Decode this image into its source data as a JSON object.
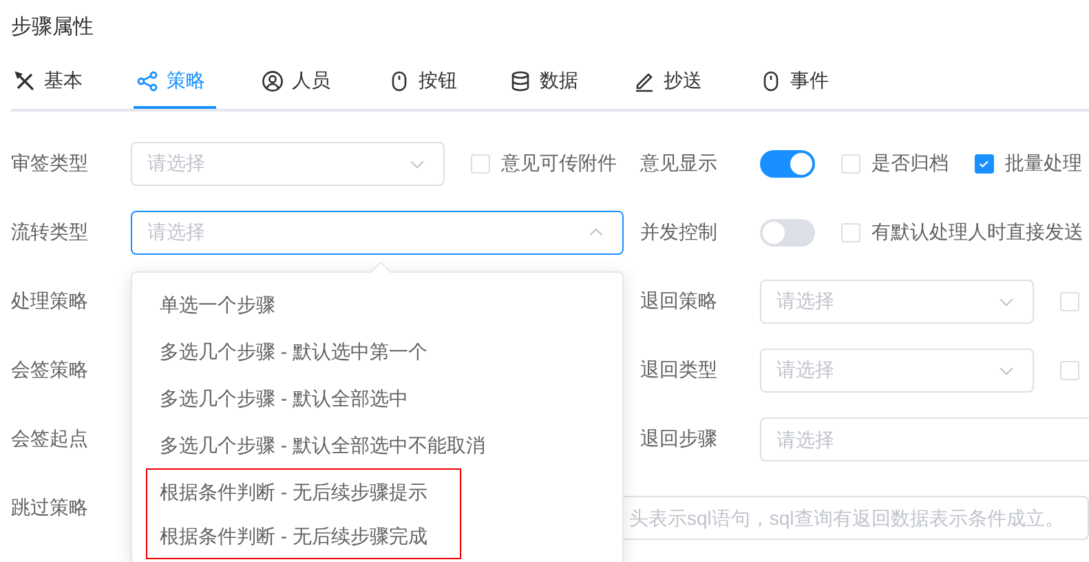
{
  "title": "步骤属性",
  "tabs": [
    {
      "label": "基本",
      "selected": false
    },
    {
      "label": "策略",
      "selected": true
    },
    {
      "label": "人员",
      "selected": false
    },
    {
      "label": "按钮",
      "selected": false
    },
    {
      "label": "数据",
      "selected": false
    },
    {
      "label": "抄送",
      "selected": false
    },
    {
      "label": "事件",
      "selected": false
    }
  ],
  "rows": [
    {
      "left": {
        "label": "审签类型",
        "select": {
          "placeholder": "请选择",
          "open": false
        },
        "checks": [
          {
            "label": "意见可传附件",
            "checked": false
          }
        ]
      },
      "right": {
        "label": "意见显示",
        "switch": {
          "on": true
        },
        "checks": [
          {
            "label": "是否归档",
            "checked": false
          },
          {
            "label": "批量处理",
            "checked": true
          }
        ]
      }
    },
    {
      "left": {
        "label": "流转类型",
        "select": {
          "placeholder": "请选择",
          "open": true
        }
      },
      "right": {
        "label": "并发控制",
        "switch": {
          "on": false
        },
        "checks": [
          {
            "label": "有默认处理人时直接发送",
            "checked": false
          }
        ]
      }
    },
    {
      "left": {
        "label": "处理策略"
      },
      "right": {
        "label": "退回策略",
        "select": {
          "placeholder": "请选择",
          "open": false
        },
        "checks": [
          {
            "checked": false
          }
        ]
      }
    },
    {
      "left": {
        "label": "会签策略"
      },
      "right": {
        "label": "退回类型",
        "select": {
          "placeholder": "请选择",
          "open": false
        },
        "checks": [
          {
            "checked": false
          }
        ]
      }
    },
    {
      "left": {
        "label": "会签起点"
      },
      "right": {
        "label": "退回步骤",
        "input": {
          "placeholder": "请选择"
        }
      }
    },
    {
      "left": {
        "label": "跳过策略",
        "input": {
          "placeholder": "头表示sql语句，sql查询有返回数据表示条件成立。"
        }
      }
    }
  ],
  "flow_menu": [
    {
      "label": "单选一个步骤",
      "boxed": false
    },
    {
      "label": "多选几个步骤 - 默认选中第一个",
      "boxed": false
    },
    {
      "label": "多选几个步骤 - 默认全部选中",
      "boxed": false
    },
    {
      "label": "多选几个步骤 - 默认全部选中不能取消",
      "boxed": false
    },
    {
      "label": "根据条件判断 - 无后续步骤提示",
      "boxed": true
    },
    {
      "label": "根据条件判断 - 无后续步骤完成",
      "boxed": true
    }
  ]
}
